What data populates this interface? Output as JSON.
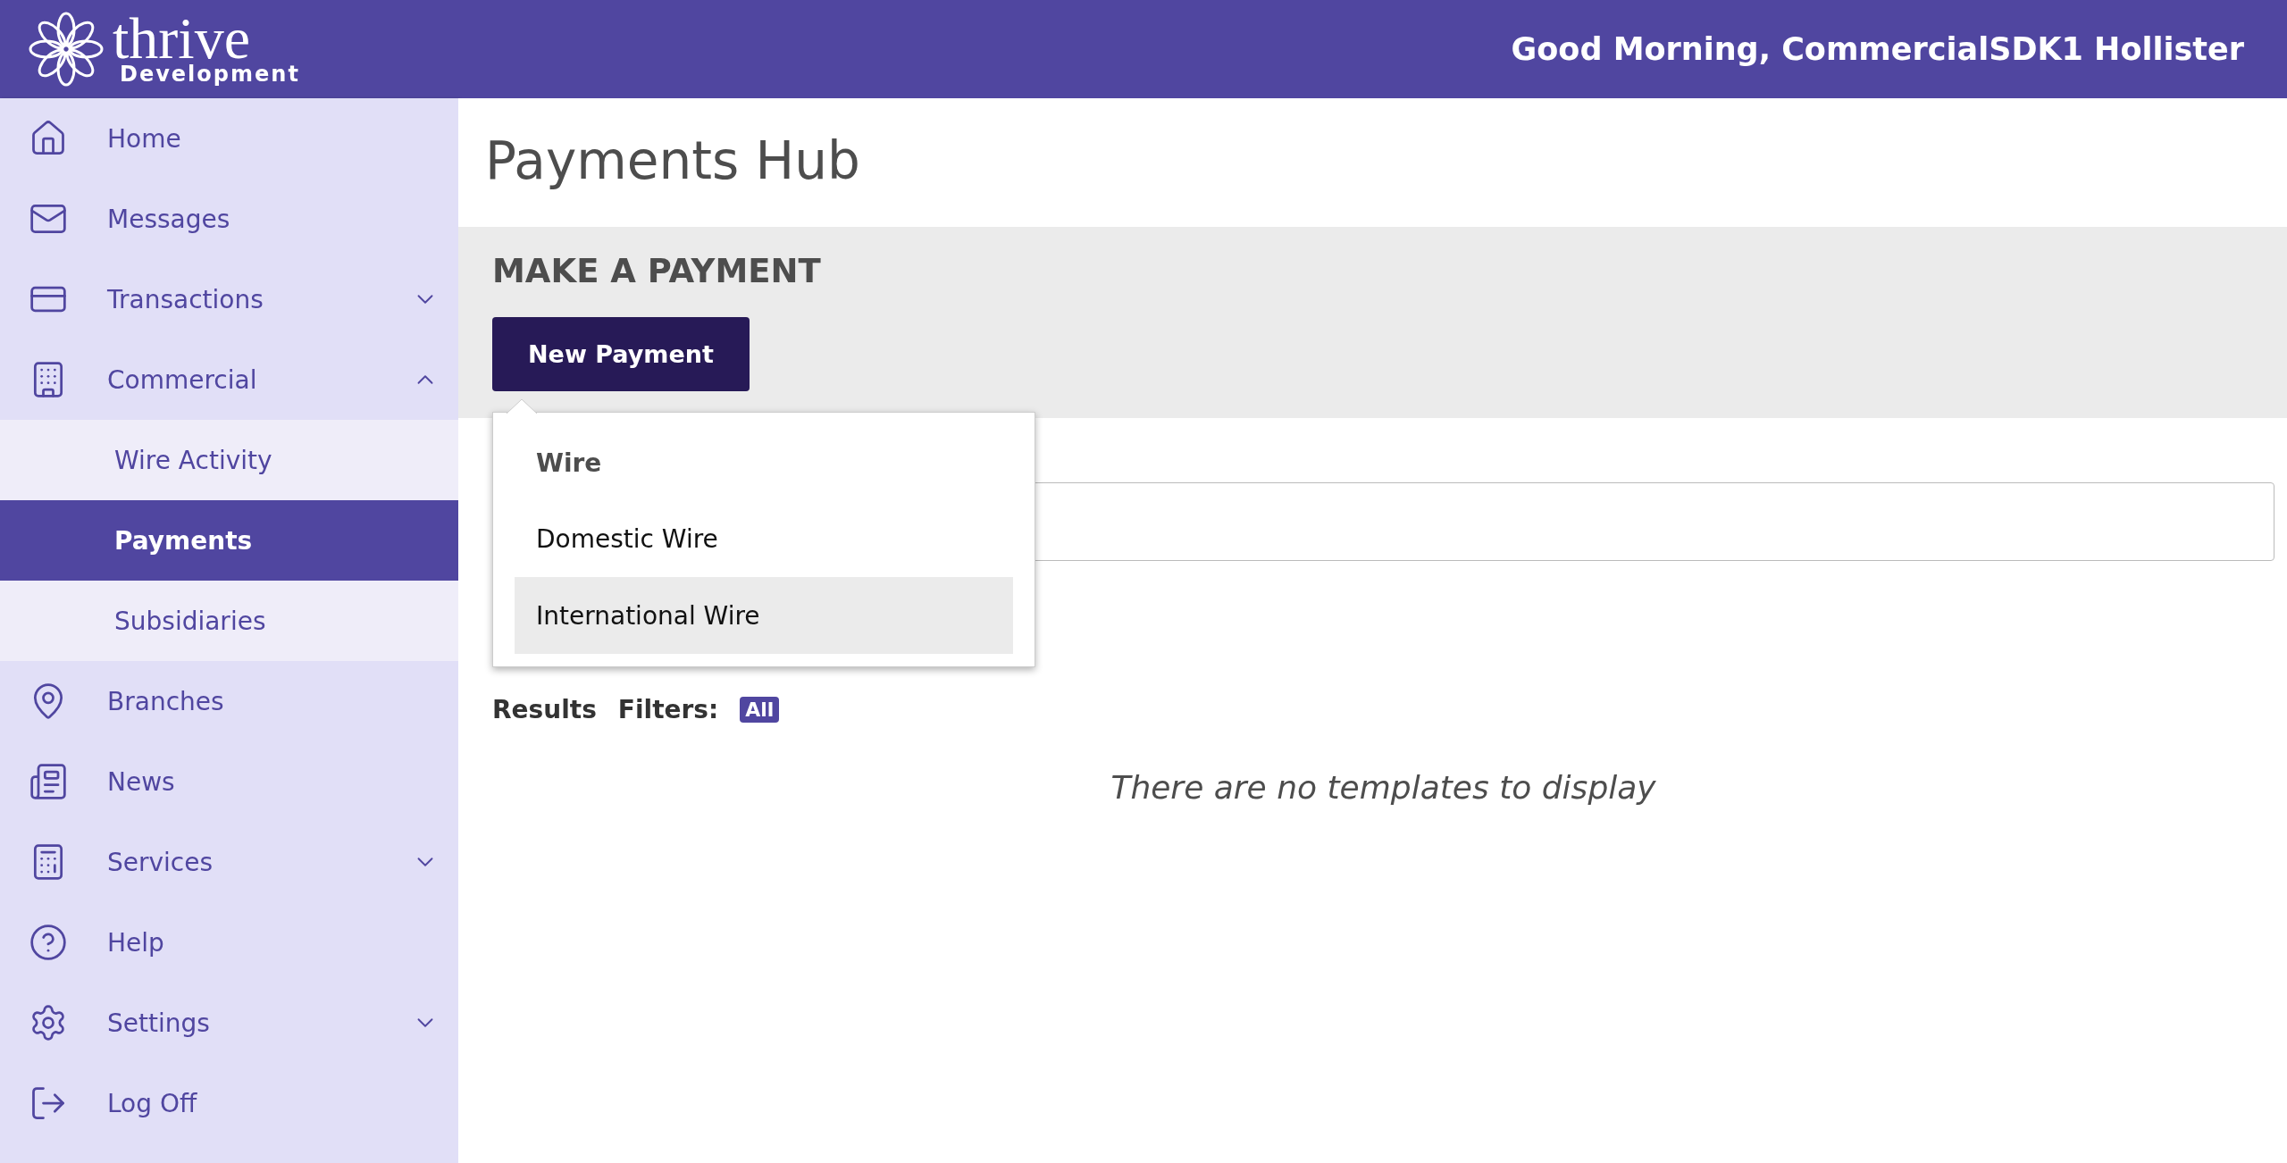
{
  "header": {
    "brand": "thrive",
    "brand_sub": "Development",
    "greeting": "Good Morning, CommercialSDK1 Hollister"
  },
  "sidebar": {
    "items": [
      {
        "label": "Home",
        "kind": "link"
      },
      {
        "label": "Messages",
        "kind": "link"
      },
      {
        "label": "Transactions",
        "kind": "group",
        "expanded": false
      },
      {
        "label": "Commercial",
        "kind": "group",
        "expanded": true,
        "children": [
          {
            "label": "Wire Activity",
            "selected": false
          },
          {
            "label": "Payments",
            "selected": true
          },
          {
            "label": "Subsidiaries",
            "selected": false
          }
        ]
      },
      {
        "label": "Branches",
        "kind": "link"
      },
      {
        "label": "News",
        "kind": "link"
      },
      {
        "label": "Services",
        "kind": "group",
        "expanded": false
      },
      {
        "label": "Help",
        "kind": "link"
      },
      {
        "label": "Settings",
        "kind": "group",
        "expanded": false
      },
      {
        "label": "Log Off",
        "kind": "link"
      }
    ]
  },
  "page": {
    "title": "Payments Hub",
    "section_title": "MAKE A PAYMENT",
    "new_payment_button": "New Payment",
    "menu": [
      {
        "label": "Wire",
        "kind": "group"
      },
      {
        "label": "Domestic Wire",
        "kind": "option",
        "selected": false
      },
      {
        "label": "International Wire",
        "kind": "option",
        "selected": true
      }
    ],
    "results_label": "Results",
    "filters_label": "Filters:",
    "filter_badge": "All",
    "empty_message": "There are no templates to display"
  }
}
